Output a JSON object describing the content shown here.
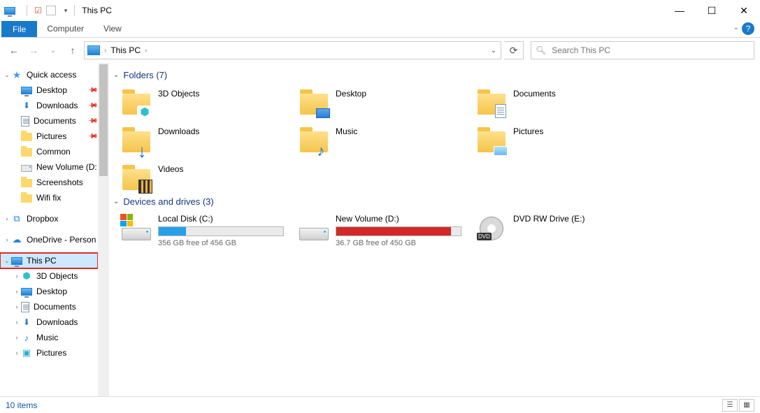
{
  "window": {
    "title": "This PC",
    "controls": {
      "min": "—",
      "max": "☐",
      "close": "✕"
    }
  },
  "ribbon": {
    "fileTab": "File",
    "tabs": [
      "Computer",
      "View"
    ]
  },
  "address": {
    "location": "This PC",
    "crumbSep": "›",
    "dropdown": "⌄",
    "refresh": "⟳",
    "searchPlaceholder": "Search This PC"
  },
  "sidebar": {
    "quickAccess": {
      "label": "Quick access",
      "items": [
        {
          "label": "Desktop",
          "icon": "monitor",
          "pinned": true
        },
        {
          "label": "Downloads",
          "icon": "dl",
          "pinned": true
        },
        {
          "label": "Documents",
          "icon": "doc",
          "pinned": true
        },
        {
          "label": "Pictures",
          "icon": "folder",
          "pinned": true
        },
        {
          "label": "Common",
          "icon": "folder",
          "pinned": false
        },
        {
          "label": "New Volume (D:",
          "icon": "drive",
          "pinned": false
        },
        {
          "label": "Screenshots",
          "icon": "folder",
          "pinned": false
        },
        {
          "label": "Wifi fix",
          "icon": "folder",
          "pinned": false
        }
      ]
    },
    "dropbox": {
      "label": "Dropbox"
    },
    "onedrive": {
      "label": "OneDrive - Person"
    },
    "thisPC": {
      "label": "This PC",
      "children": [
        {
          "label": "3D Objects",
          "icon": "cube"
        },
        {
          "label": "Desktop",
          "icon": "monitor"
        },
        {
          "label": "Documents",
          "icon": "doc"
        },
        {
          "label": "Downloads",
          "icon": "dl"
        },
        {
          "label": "Music",
          "icon": "music"
        },
        {
          "label": "Pictures",
          "icon": "pic"
        }
      ]
    }
  },
  "content": {
    "foldersHeader": "Folders (7)",
    "folders": [
      {
        "label": "3D Objects",
        "overlay": "cube"
      },
      {
        "label": "Desktop",
        "overlay": "desktop"
      },
      {
        "label": "Documents",
        "overlay": "doc"
      },
      {
        "label": "Downloads",
        "overlay": "arrow"
      },
      {
        "label": "Music",
        "overlay": "note"
      },
      {
        "label": "Pictures",
        "overlay": "pic"
      },
      {
        "label": "Videos",
        "overlay": "film"
      }
    ],
    "drivesHeader": "Devices and drives (3)",
    "drives": [
      {
        "name": "Local Disk (C:)",
        "sub": "356 GB free of 456 GB",
        "fillPct": 22,
        "fillColor": "#26a0e8",
        "winlogo": true
      },
      {
        "name": "New Volume (D:)",
        "sub": "36.7 GB free of 450 GB",
        "fillPct": 92,
        "fillColor": "#d22828",
        "winlogo": false
      },
      {
        "name": "DVD RW Drive (E:)",
        "sub": "",
        "type": "dvd"
      }
    ]
  },
  "statusbar": {
    "text": "10 items"
  }
}
